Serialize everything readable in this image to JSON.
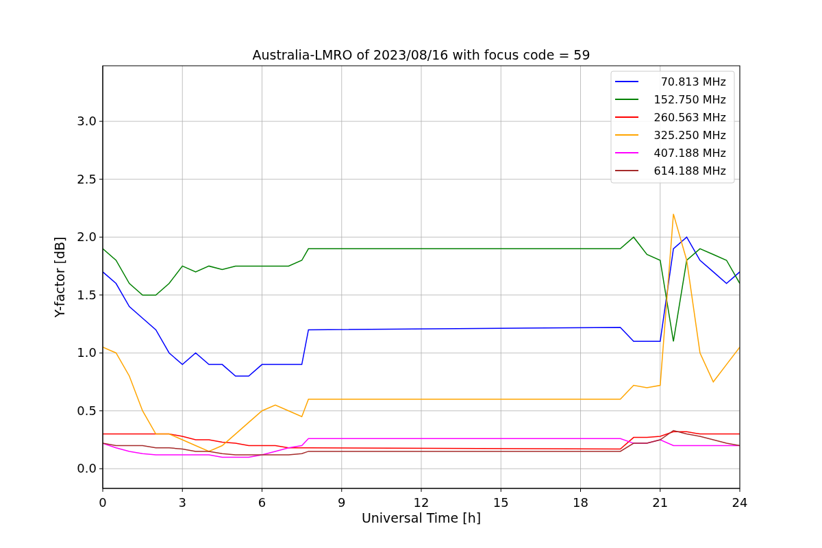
{
  "figure": {
    "chart_data": {
      "type": "line",
      "title": "Australia-LMRO of 2023/08/16 with focus code = 59",
      "xlabel": "Universal Time [h]",
      "ylabel": "Y-factor [dB]",
      "x": [
        0,
        0.5,
        1,
        1.5,
        2,
        2.5,
        3,
        3.5,
        4,
        4.5,
        5,
        5.5,
        6,
        6.5,
        7,
        7.5,
        7.75,
        19.5,
        20,
        20.5,
        21,
        21.5,
        22,
        22.5,
        23,
        23.5,
        24
      ],
      "series": [
        {
          "name": "70.813 MHz",
          "color": "#0000ff",
          "values": [
            1.7,
            1.6,
            1.4,
            1.3,
            1.2,
            1.0,
            0.9,
            1.0,
            0.9,
            0.9,
            0.8,
            0.8,
            0.9,
            0.9,
            0.9,
            0.9,
            1.2,
            1.22,
            1.1,
            1.1,
            1.1,
            1.9,
            2.0,
            1.8,
            1.7,
            1.6,
            1.7
          ]
        },
        {
          "name": "152.750 MHz",
          "color": "#008000",
          "values": [
            1.9,
            1.8,
            1.6,
            1.5,
            1.5,
            1.6,
            1.75,
            1.7,
            1.75,
            1.72,
            1.75,
            1.75,
            1.75,
            1.75,
            1.75,
            1.8,
            1.9,
            1.9,
            2.0,
            1.85,
            1.8,
            1.1,
            1.8,
            1.9,
            1.85,
            1.8,
            1.6
          ]
        },
        {
          "name": "260.563 MHz",
          "color": "#ff0000",
          "values": [
            0.3,
            0.3,
            0.3,
            0.3,
            0.3,
            0.3,
            0.28,
            0.25,
            0.25,
            0.23,
            0.22,
            0.2,
            0.2,
            0.2,
            0.18,
            0.18,
            0.18,
            0.17,
            0.27,
            0.27,
            0.28,
            0.32,
            0.32,
            0.3,
            0.3,
            0.3,
            0.3
          ]
        },
        {
          "name": "325.250 MHz",
          "color": "#ffa500",
          "values": [
            1.05,
            1.0,
            0.8,
            0.5,
            0.3,
            0.3,
            0.25,
            0.2,
            0.15,
            0.2,
            0.3,
            0.4,
            0.5,
            0.55,
            0.5,
            0.45,
            0.6,
            0.6,
            0.72,
            0.7,
            0.72,
            2.2,
            1.8,
            1.0,
            0.75,
            0.9,
            1.05
          ]
        },
        {
          "name": "407.188 MHz",
          "color": "#ff00ff",
          "values": [
            0.22,
            0.18,
            0.15,
            0.13,
            0.12,
            0.12,
            0.12,
            0.12,
            0.12,
            0.1,
            0.1,
            0.1,
            0.12,
            0.15,
            0.18,
            0.2,
            0.26,
            0.26,
            0.22,
            0.22,
            0.25,
            0.2,
            0.2,
            0.2,
            0.2,
            0.2,
            0.2
          ]
        },
        {
          "name": "614.188 MHz",
          "color": "#a52a2a",
          "values": [
            0.22,
            0.2,
            0.2,
            0.2,
            0.18,
            0.18,
            0.17,
            0.15,
            0.15,
            0.13,
            0.12,
            0.12,
            0.12,
            0.12,
            0.12,
            0.13,
            0.15,
            0.15,
            0.22,
            0.22,
            0.25,
            0.33,
            0.3,
            0.28,
            0.25,
            0.22,
            0.2
          ]
        }
      ],
      "grid": true,
      "legend": true,
      "xlim": [
        0,
        24
      ],
      "ylim": [
        -0.17,
        3.48
      ],
      "xticks": [
        0,
        3,
        6,
        9,
        12,
        15,
        18,
        21,
        24
      ],
      "yticks": [
        {
          "value": 0,
          "label": "0.0"
        },
        {
          "value": 0.5,
          "label": "0.5"
        },
        {
          "value": 1,
          "label": "1.0"
        },
        {
          "value": 1.5,
          "label": "1.5"
        },
        {
          "value": 2,
          "label": "2.0"
        },
        {
          "value": 2.5,
          "label": "2.5"
        },
        {
          "value": 3,
          "label": "3.0"
        }
      ]
    }
  }
}
